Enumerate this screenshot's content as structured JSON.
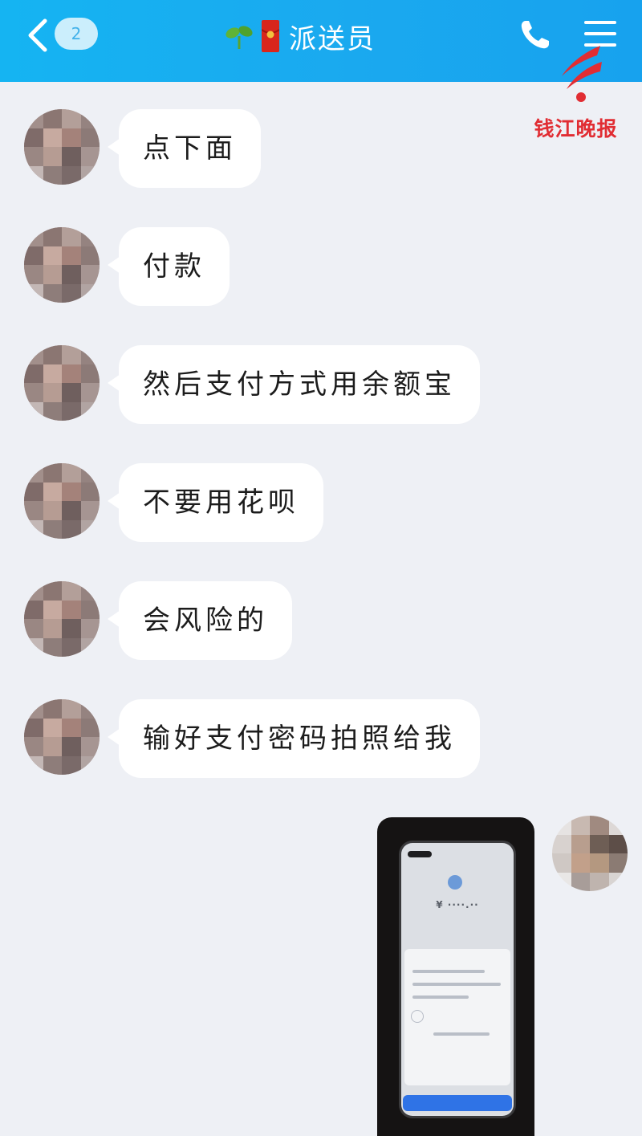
{
  "header": {
    "unread_count": "2",
    "title": "派送员",
    "icons": [
      "back-icon",
      "sprout-icon",
      "red-packet-icon",
      "phone-icon",
      "menu-icon"
    ],
    "background": "#1aa9ef"
  },
  "watermark": {
    "text": "钱江晚报",
    "color": "#e12d33"
  },
  "messages": [
    {
      "direction": "incoming",
      "text": "点下面"
    },
    {
      "direction": "incoming",
      "text": "付款"
    },
    {
      "direction": "incoming",
      "text": "然后支付方式用余额宝"
    },
    {
      "direction": "incoming",
      "text": "不要用花呗"
    },
    {
      "direction": "incoming",
      "text": "会风险的"
    },
    {
      "direction": "incoming",
      "text": "输好支付密码拍照给我"
    }
  ],
  "outgoing_image": {
    "type": "photo",
    "description_text": ""
  },
  "colors": {
    "chat_background": "#eef0f5",
    "bubble": "#ffffff",
    "text": "#1c1c1c"
  }
}
